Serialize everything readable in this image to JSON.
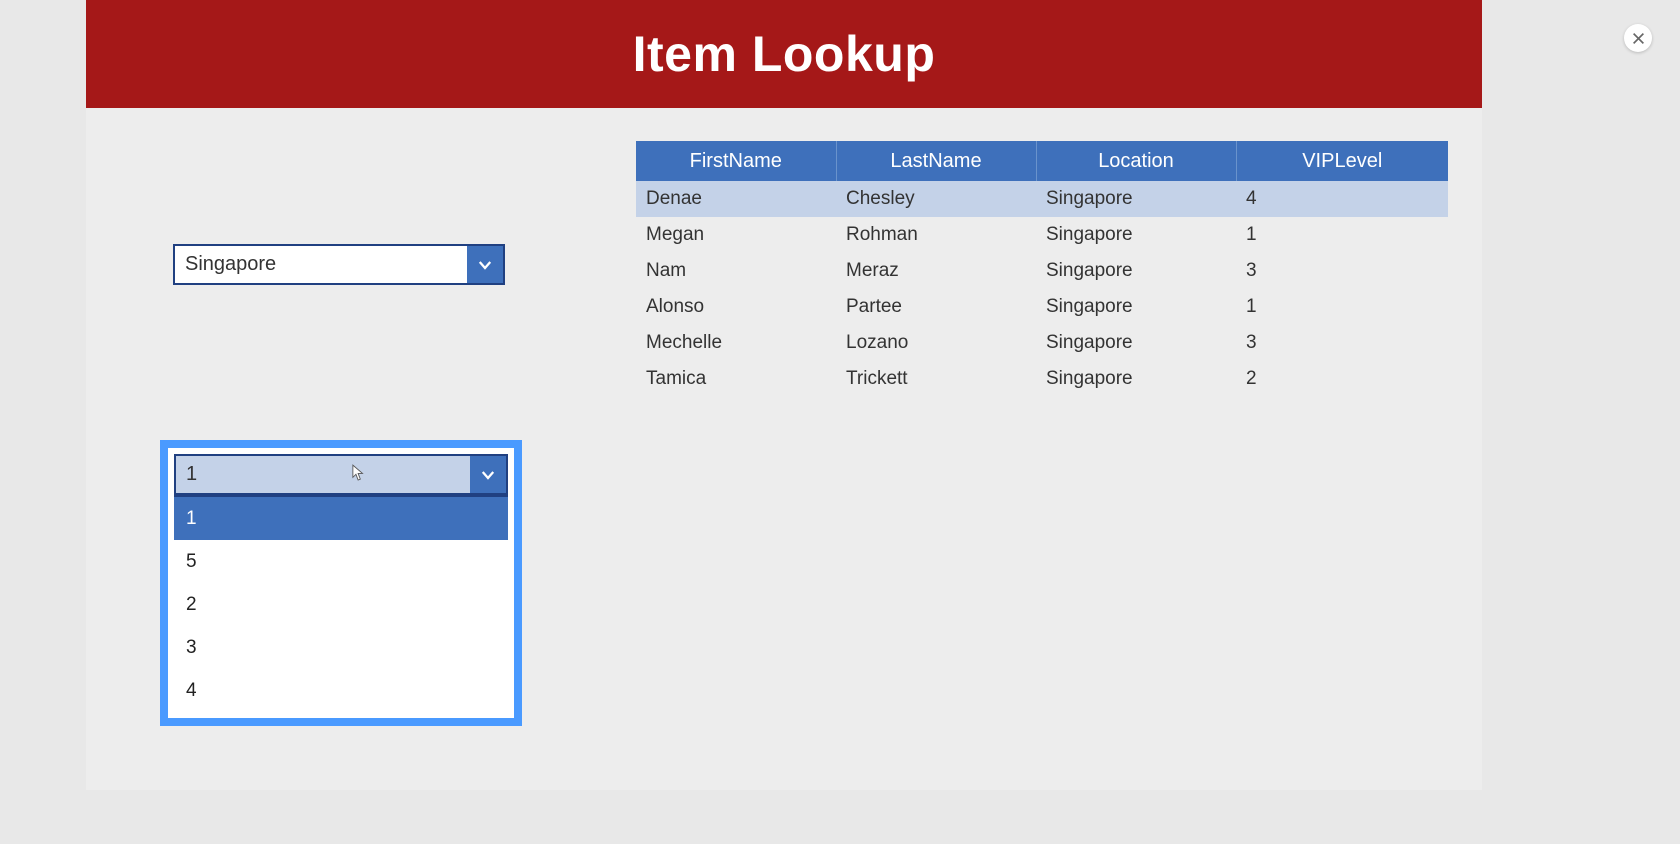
{
  "header": {
    "title": "Item Lookup"
  },
  "location_dropdown": {
    "value": "Singapore"
  },
  "vip_dropdown": {
    "value": "1",
    "options": [
      "1",
      "5",
      "2",
      "3",
      "4"
    ],
    "selected_index": 0
  },
  "table": {
    "columns": [
      "FirstName",
      "LastName",
      "Location",
      "VIPLevel"
    ],
    "rows": [
      {
        "first": "Denae",
        "last": "Chesley",
        "location": "Singapore",
        "vip": "4",
        "selected": true
      },
      {
        "first": "Megan",
        "last": "Rohman",
        "location": "Singapore",
        "vip": "1",
        "selected": false
      },
      {
        "first": "Nam",
        "last": "Meraz",
        "location": "Singapore",
        "vip": "3",
        "selected": false
      },
      {
        "first": "Alonso",
        "last": "Partee",
        "location": "Singapore",
        "vip": "1",
        "selected": false
      },
      {
        "first": "Mechelle",
        "last": "Lozano",
        "location": "Singapore",
        "vip": "3",
        "selected": false
      },
      {
        "first": "Tamica",
        "last": "Trickett",
        "location": "Singapore",
        "vip": "2",
        "selected": false
      }
    ]
  }
}
